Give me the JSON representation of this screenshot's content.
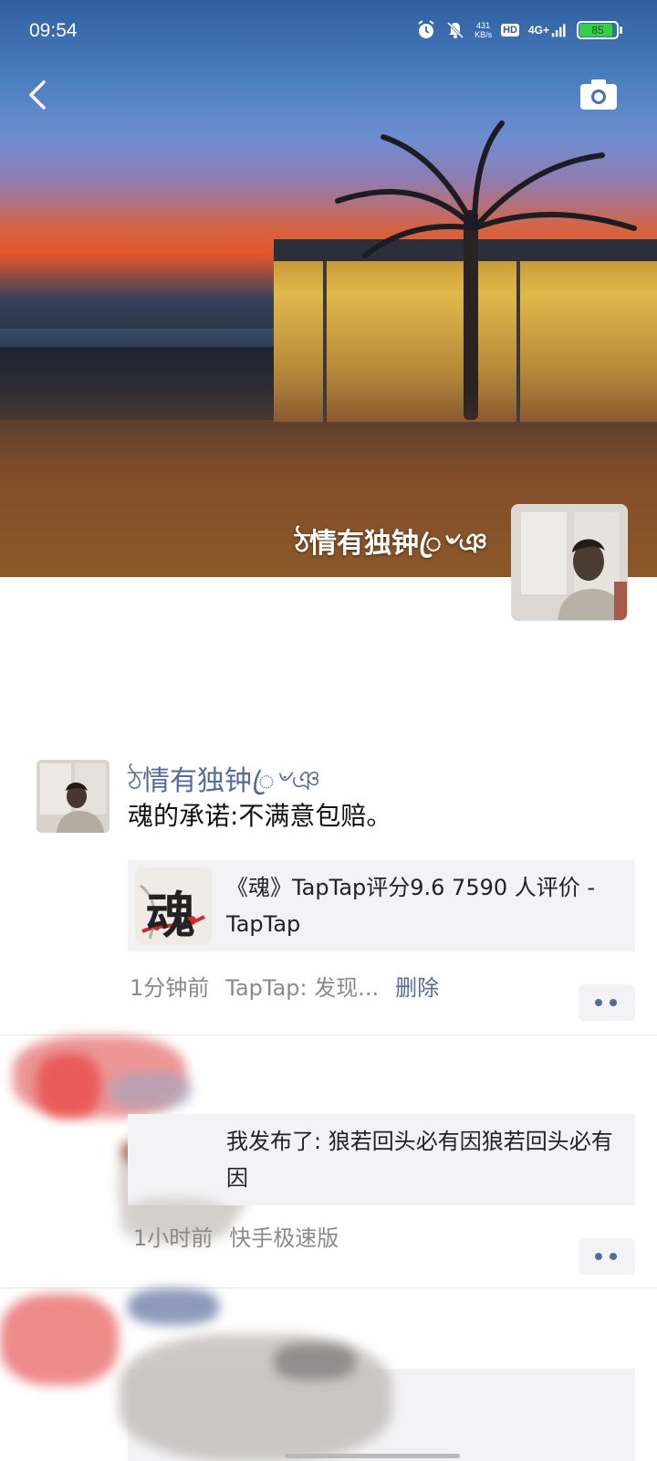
{
  "status_bar": {
    "time": "09:54",
    "speed_value": "431",
    "speed_unit": "KB/s",
    "hd": "HD",
    "network": "4G+",
    "battery": "85"
  },
  "cover": {
    "name": "ঠ情有独钟ꦿ৺ঞ"
  },
  "posts": [
    {
      "name": "ঠ情有独钟ꦿ৺ঞ",
      "text": "魂的承诺:不满意包赔。",
      "link_title": "《魂》TapTap评分9.6 7590 人评价 - TapTap",
      "link_icon_char": "魂",
      "time": "1分钟前",
      "source": "TapTap: 发现...",
      "delete": "删除"
    },
    {
      "text": "我发布了: 狼若回头必有因狼若回头必有因",
      "time": "1小时前",
      "source": "快手极速版"
    }
  ],
  "colors": {
    "link_blue": "#576b95",
    "card_bg": "#f3f3f5",
    "meta_gray": "#8a8a8a"
  }
}
